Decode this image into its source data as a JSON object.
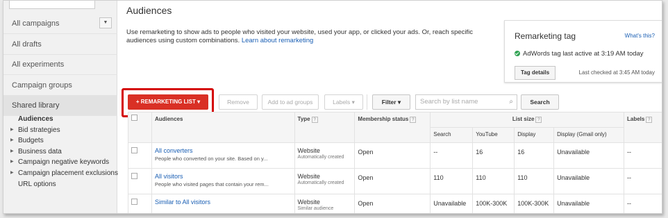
{
  "sidebar": {
    "items": [
      {
        "label": "All campaigns"
      },
      {
        "label": "All drafts"
      },
      {
        "label": "All experiments"
      },
      {
        "label": "Campaign groups"
      },
      {
        "label": "Shared library"
      }
    ],
    "dropdown_glyph": "▼",
    "sub_items": [
      {
        "label": "Audiences",
        "bold": true,
        "expandable": false
      },
      {
        "label": "Bid strategies",
        "expandable": true
      },
      {
        "label": "Budgets",
        "expandable": true
      },
      {
        "label": "Business data",
        "expandable": true
      },
      {
        "label": "Campaign negative keywords",
        "expandable": true
      },
      {
        "label": "Campaign placement exclusions",
        "expandable": true
      },
      {
        "label": "URL options",
        "expandable": false
      }
    ]
  },
  "page": {
    "title": "Audiences",
    "intro_text": "Use remarketing to show ads to people who visited your website, used your app, or clicked your ads. Or, reach specific audiences using custom combinations.",
    "intro_link": "Learn about remarketing"
  },
  "tag_box": {
    "title": "Remarketing tag",
    "help_link": "What's this?",
    "status": "AdWords tag last active at 3:19 AM today",
    "button": "Tag details",
    "last_checked": "Last checked at 3:45 AM today"
  },
  "toolbar": {
    "remarketing_list": "REMARKETING LIST",
    "remove": "Remove",
    "add_to_ad_groups": "Add to ad groups",
    "labels": "Labels",
    "filter": "Filter",
    "search_placeholder": "Search by list name",
    "search_button": "Search"
  },
  "table": {
    "headers": {
      "audiences": "Audiences",
      "type": "Type",
      "membership_status": "Membership status",
      "list_size": "List size",
      "labels": "Labels",
      "search": "Search",
      "youtube": "YouTube",
      "display": "Display",
      "display_gmail": "Display (Gmail only)"
    },
    "rows": [
      {
        "name": "All converters",
        "desc": "People who converted on your site. Based on y...",
        "type": "Website",
        "type_sub": "Automatically created",
        "status": "Open",
        "search": "--",
        "youtube": "16",
        "display": "16",
        "gmail": "Unavailable",
        "labels": "--"
      },
      {
        "name": "All visitors",
        "desc": "People who visited pages that contain your rem...",
        "type": "Website",
        "type_sub": "Automatically created",
        "status": "Open",
        "search": "110",
        "youtube": "110",
        "display": "110",
        "gmail": "Unavailable",
        "labels": "--"
      },
      {
        "name": "Similar to All visitors",
        "desc": "",
        "type": "Website",
        "type_sub": "Similar audience",
        "status": "Open",
        "search": "Unavailable",
        "youtube": "100K-300K",
        "display": "100K-300K",
        "gmail": "Unavailable",
        "labels": "--"
      }
    ]
  }
}
